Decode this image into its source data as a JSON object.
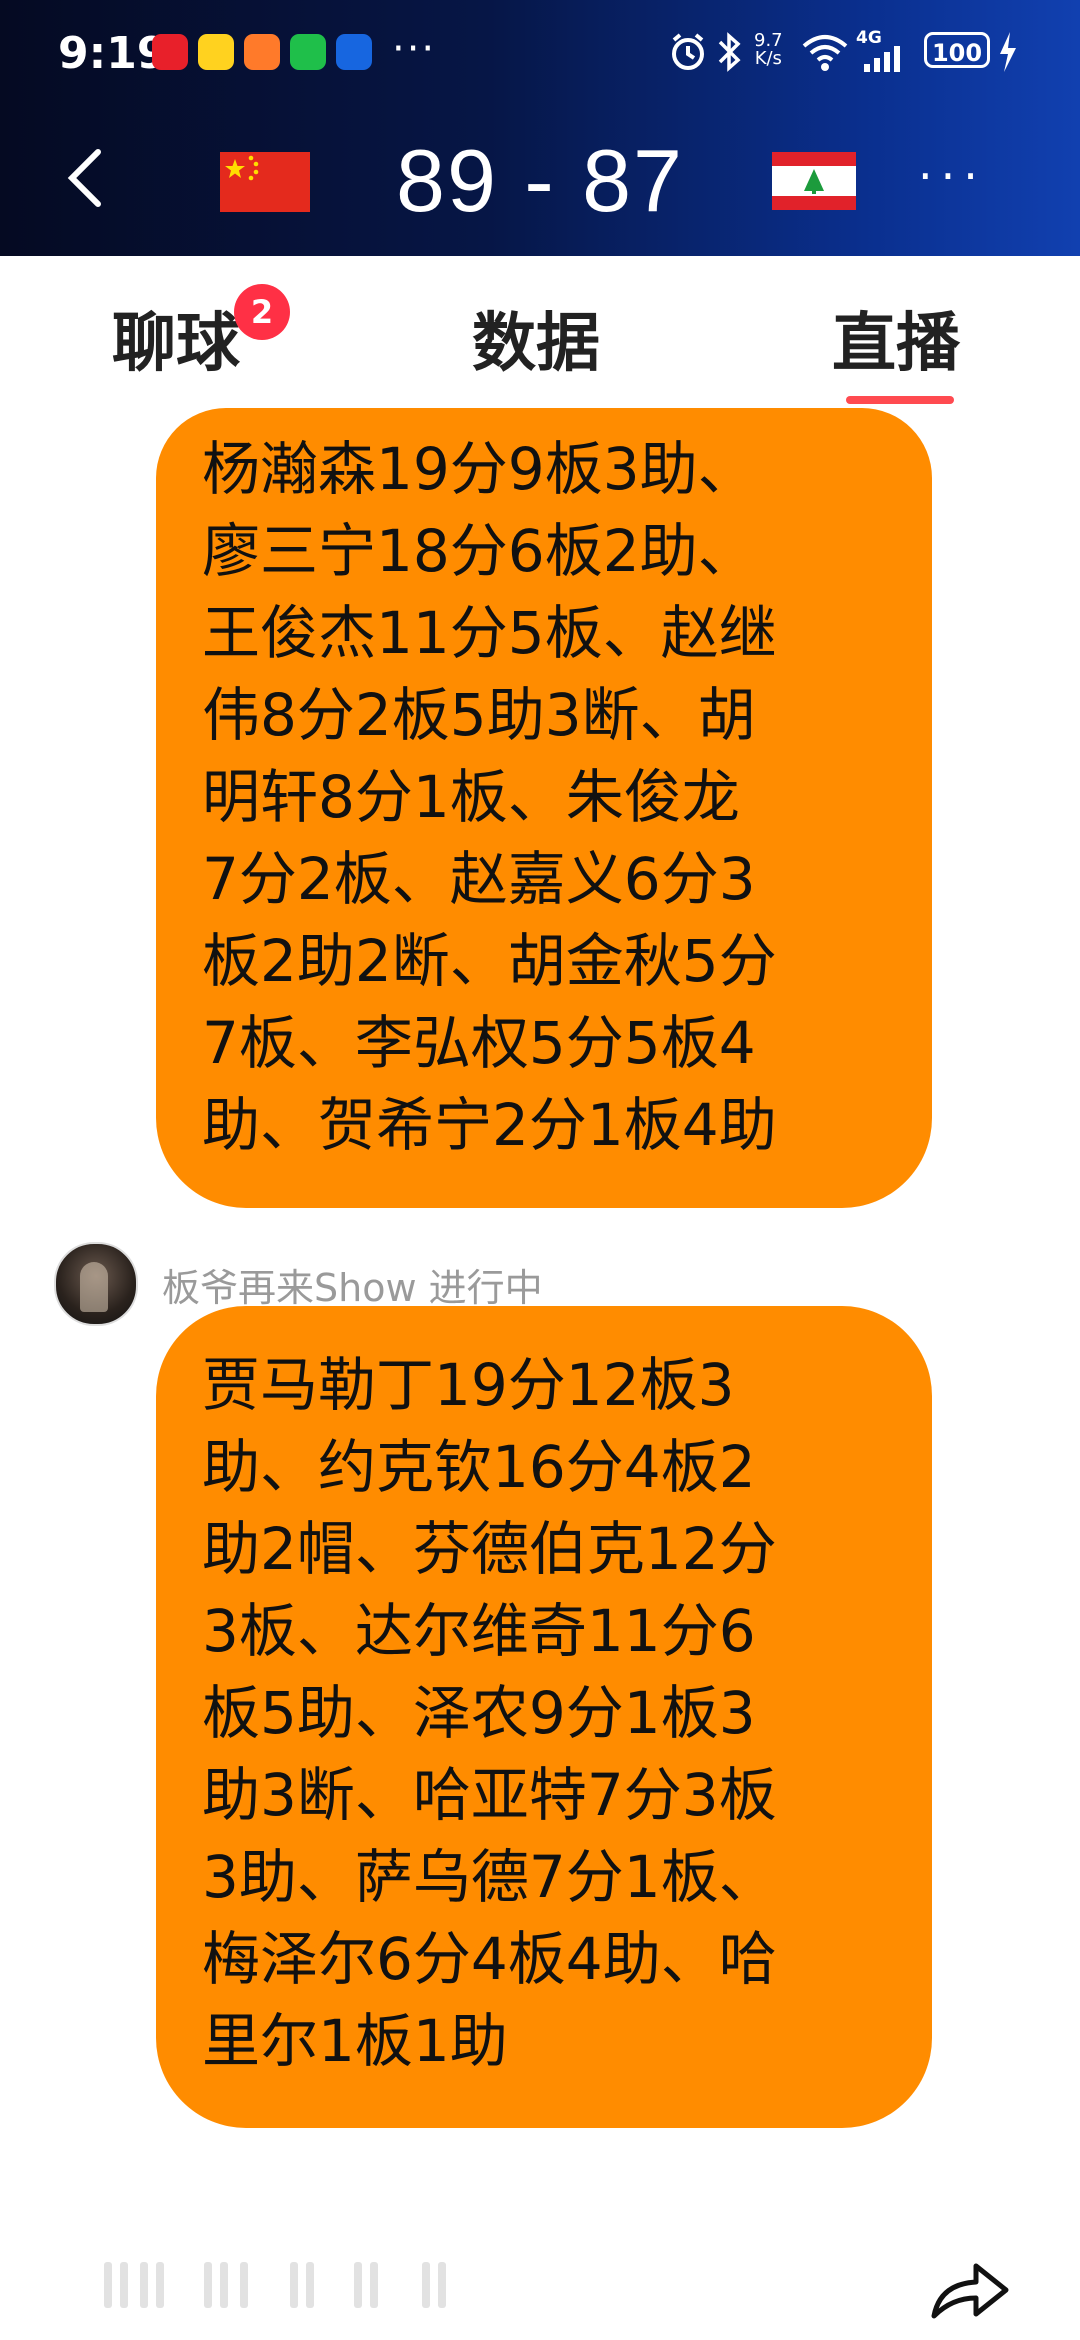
{
  "status_bar": {
    "time": "9:19",
    "overflow": "···",
    "net_speed_top": "9.7",
    "net_speed_bottom": "K/s",
    "signal": "4G",
    "battery": "100"
  },
  "header": {
    "score": "89 - 87",
    "home_flag": "china-flag",
    "away_flag": "lebanon-flag",
    "more": "···"
  },
  "tabs": [
    {
      "label": "聊球",
      "badge": "2"
    },
    {
      "label": "数据"
    },
    {
      "label": "直播",
      "active": true
    }
  ],
  "messages": [
    {
      "lines": [
        "杨瀚森19分9板3助、",
        "廖三宁18分6板2助、",
        "王俊杰11分5板、赵继",
        "伟8分2板5助3断、胡",
        "明轩8分1板、朱俊龙",
        "7分2板、赵嘉义6分3",
        "板2助2断、胡金秋5分",
        "7板、李弘权5分5板4",
        "助、贺希宁2分1板4助"
      ]
    },
    {
      "username": "板爷再来Show 进行中",
      "lines": [
        "贾马勒丁19分12板3",
        "助、约克钦16分4板2",
        "助2帽、芬德伯克12分",
        "3板、达尔维奇11分6",
        "板5助、泽农9分1板3",
        "助3断、哈亚特7分3板",
        "3助、萨乌德7分1板、",
        "梅泽尔6分4板4助、哈",
        "里尔1板1助"
      ]
    }
  ],
  "colors": {
    "bubble": "#ff8c00",
    "badge": "#ff3045",
    "tab_indicator": "#ff4a50",
    "header_start": "#050a22",
    "header_end": "#1140b0"
  }
}
